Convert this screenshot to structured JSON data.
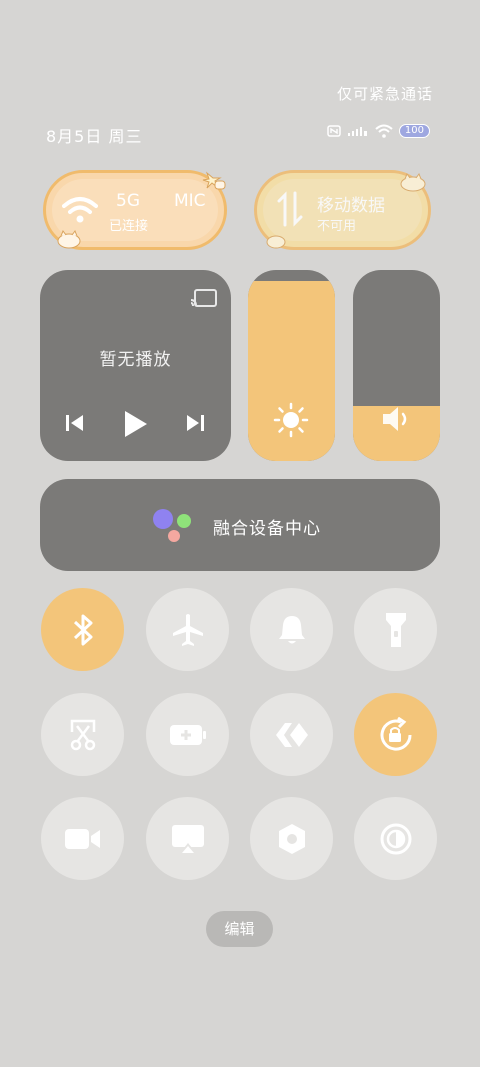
{
  "header": {
    "emergency_text": "仅可紧急通话",
    "date": "8月5日 周三",
    "battery": "100"
  },
  "wifi_tile": {
    "line1": "5G",
    "line1b": "MIC",
    "line2": "已连接"
  },
  "data_tile": {
    "line1": "移动数据",
    "line2": "不可用"
  },
  "media": {
    "title": "暂无播放"
  },
  "brightness_level": 0.94,
  "volume_level": 0.29,
  "fusion": {
    "label": "融合设备中心"
  },
  "toggles": [
    {
      "name": "bluetooth",
      "on": true
    },
    {
      "name": "airplane",
      "on": false
    },
    {
      "name": "ring",
      "on": false
    },
    {
      "name": "flashlight",
      "on": false
    },
    {
      "name": "screenshot",
      "on": false
    },
    {
      "name": "battery-saver",
      "on": false
    },
    {
      "name": "nearby",
      "on": false
    },
    {
      "name": "rotation-lock",
      "on": true
    },
    {
      "name": "screen-record",
      "on": false
    },
    {
      "name": "cast",
      "on": false
    },
    {
      "name": "settings",
      "on": false
    },
    {
      "name": "dark-mode",
      "on": false
    }
  ],
  "edit_label": "编辑",
  "colors": {
    "accent": "#f3c57a",
    "card": "#7b7a78",
    "tile": "#e6e5e3",
    "background": "#d6d5d3"
  }
}
